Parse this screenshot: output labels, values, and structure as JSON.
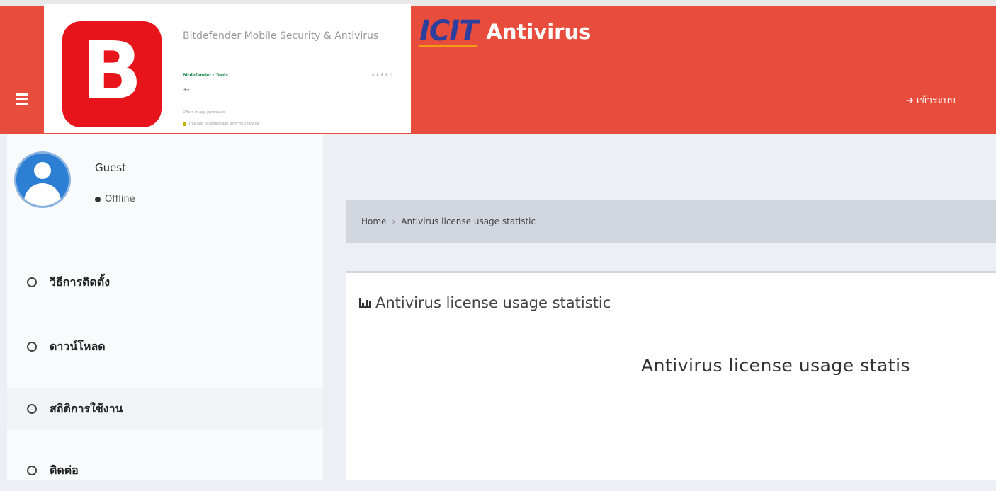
{
  "header": {
    "brand_logo": "ICIT",
    "brand_name": "Antivirus",
    "login_label": "เข้าระบบ",
    "accent_color": "#e74c3c"
  },
  "store_card": {
    "app_icon_letter": "B",
    "app_title": "Bitdefender Mobile Security & Antivirus",
    "developer": "Bitdefender · Tools",
    "rating": "★★★★☆",
    "age_rating": "3+",
    "note1": "Offers in-app purchases",
    "note2": "This app is compatible with your device"
  },
  "sidebar": {
    "user": {
      "name": "Guest",
      "status": "Offline"
    },
    "items": [
      {
        "label": "วิธีการติดตั้ง"
      },
      {
        "label": "ดาวน์โหลด"
      },
      {
        "label": "สถิติการใช้งาน"
      },
      {
        "label": "ติดต่อ"
      }
    ]
  },
  "breadcrumb": {
    "home": "Home",
    "separator": "›",
    "current": "Antivirus license usage statistic"
  },
  "panel": {
    "icon": "bar-chart-icon",
    "title": "Antivirus license usage statistic",
    "chart_title": "Antivirus license usage statis"
  }
}
